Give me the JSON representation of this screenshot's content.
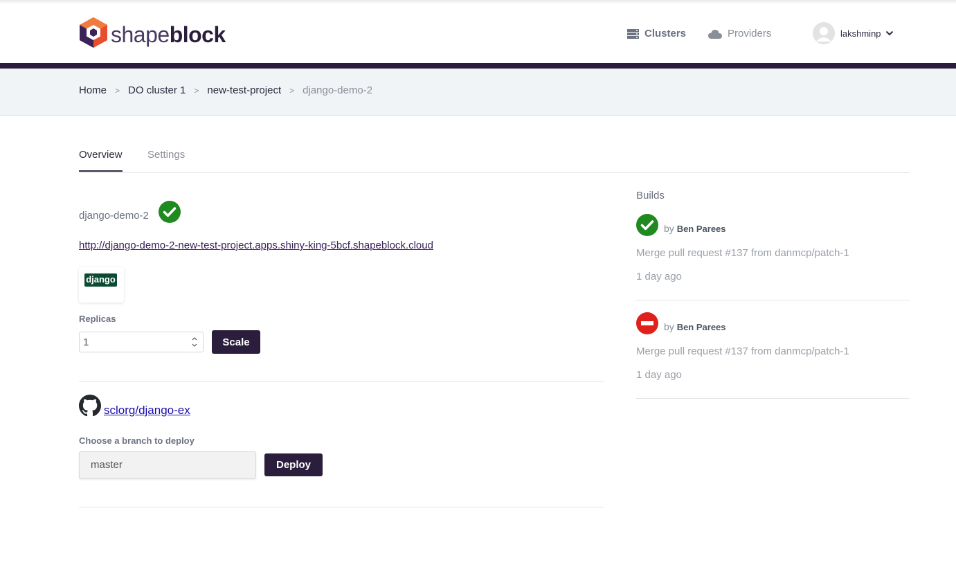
{
  "header": {
    "logo": {
      "part1": "shape",
      "part2": "block"
    },
    "nav": [
      {
        "label": "Clusters",
        "icon": "server-icon"
      },
      {
        "label": "Providers",
        "icon": "cloud-icon"
      }
    ],
    "user": {
      "name": "lakshminp"
    }
  },
  "breadcrumb": {
    "items": [
      "Home",
      "DO cluster 1",
      "new-test-project"
    ],
    "current": "django-demo-2",
    "separator": ">"
  },
  "tabs": [
    "Overview",
    "Settings"
  ],
  "app": {
    "name": "django-demo-2",
    "url": "http://django-demo-2-new-test-project.apps.shiny-king-5bcf.shapeblock.cloud",
    "framework_badge": "django",
    "replicas_label": "Replicas",
    "replicas_value": "1",
    "scale_label": "Scale",
    "status_color": "#1f8a1f"
  },
  "repo": {
    "name": "sclorg/django-ex",
    "branch_label": "Choose a branch to deploy",
    "branch_value": "master",
    "deploy_label": "Deploy"
  },
  "builds": {
    "title": "Builds",
    "items": [
      {
        "status": "success",
        "by": "by",
        "author": "Ben Parees",
        "message": "Merge pull request #137 from danmcp/patch-1",
        "time": "1 day ago"
      },
      {
        "status": "failed",
        "by": "by",
        "author": "Ben Parees",
        "message": "Merge pull request #137 from danmcp/patch-1",
        "time": "1 day ago"
      }
    ]
  },
  "colors": {
    "brand": "#2b1e3d",
    "success": "#1f8a1f",
    "error": "#e0201a",
    "logo_orange": "#e94e2c"
  }
}
